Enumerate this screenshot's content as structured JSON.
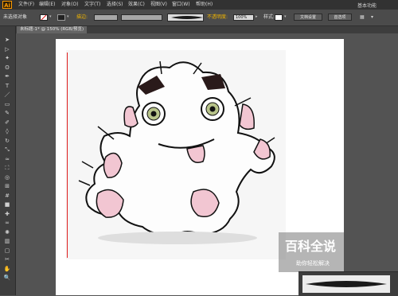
{
  "app": {
    "logo": "Ai",
    "workspace": "基本功能"
  },
  "menu": [
    "文件(F)",
    "编辑(E)",
    "对象(O)",
    "文字(T)",
    "选择(S)",
    "效果(C)",
    "视图(V)",
    "窗口(W)",
    "帮助(H)"
  ],
  "control": {
    "selection": "未选择对象",
    "stroke_label": "描边:",
    "opacity_label": "不透明度:",
    "opacity_value": "100%",
    "style_label": "样式:",
    "doc_setup": "文档设置",
    "preferences": "首选项"
  },
  "document": {
    "tab": "未标题-1* @ 150% (RGB/预览)"
  },
  "watermark": {
    "title": "百科全说",
    "subtitle": "助你轻松解决"
  },
  "colors": {
    "accent": "#ff9a00",
    "artboard": "#ffffff",
    "redline": "#e02020",
    "monster_pink": "#f2c6d2",
    "monster_eyes": "#b8c48a"
  },
  "icons": [
    "selection-icon",
    "direct-selection-icon",
    "magic-wand-icon",
    "lasso-icon",
    "pen-icon",
    "type-icon",
    "line-icon",
    "rectangle-icon",
    "paintbrush-icon",
    "pencil-icon",
    "eraser-icon",
    "rotate-icon",
    "scale-icon",
    "width-icon",
    "free-transform-icon",
    "shape-builder-icon",
    "perspective-icon",
    "mesh-icon",
    "gradient-icon",
    "eyedropper-icon",
    "blend-icon",
    "symbol-sprayer-icon",
    "column-graph-icon",
    "artboard-icon",
    "slice-icon",
    "hand-icon",
    "zoom-icon"
  ]
}
